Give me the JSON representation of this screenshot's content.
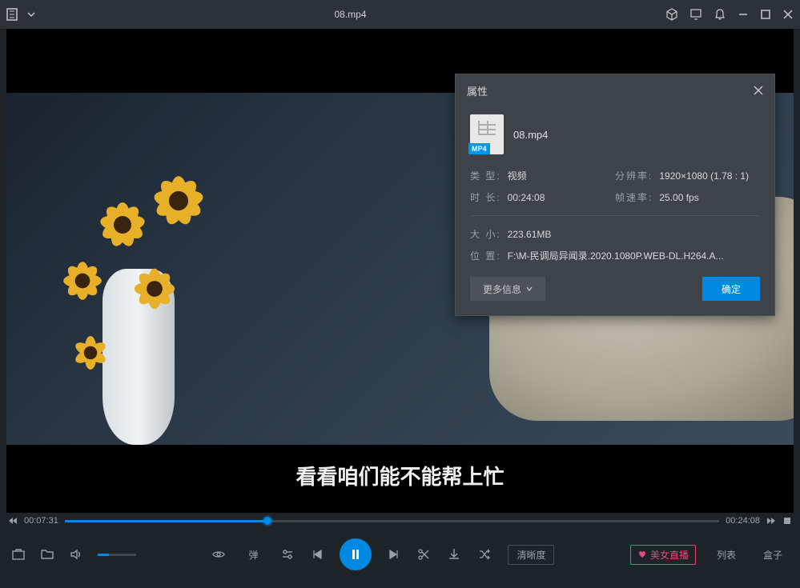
{
  "titlebar": {
    "title": "08.mp4"
  },
  "video": {
    "subtitle": "看看咱们能不能帮上忙",
    "current_time": "00:07:31",
    "total_time": "00:24:08",
    "progress_percent": 31
  },
  "dialog": {
    "title": "属性",
    "filename": "08.mp4",
    "file_badge": "MP4",
    "labels": {
      "type": "类 型:",
      "duration": "时 长:",
      "resolution": "分辨率:",
      "framerate": "帧速率:",
      "size": "大 小:",
      "location": "位 置:"
    },
    "values": {
      "type": "视频",
      "duration": "00:24:08",
      "resolution": "1920×1080 (1.78 : 1)",
      "framerate": "25.00 fps",
      "size": "223.61MB",
      "location": "F:\\M-民调局异闻录.2020.1080P.WEB-DL.H264.A..."
    },
    "more_info": "更多信息",
    "ok": "确定"
  },
  "controls": {
    "danmu": "弹",
    "quality": "清晰度",
    "live": "美女直播",
    "list": "列表",
    "box": "盒子"
  }
}
